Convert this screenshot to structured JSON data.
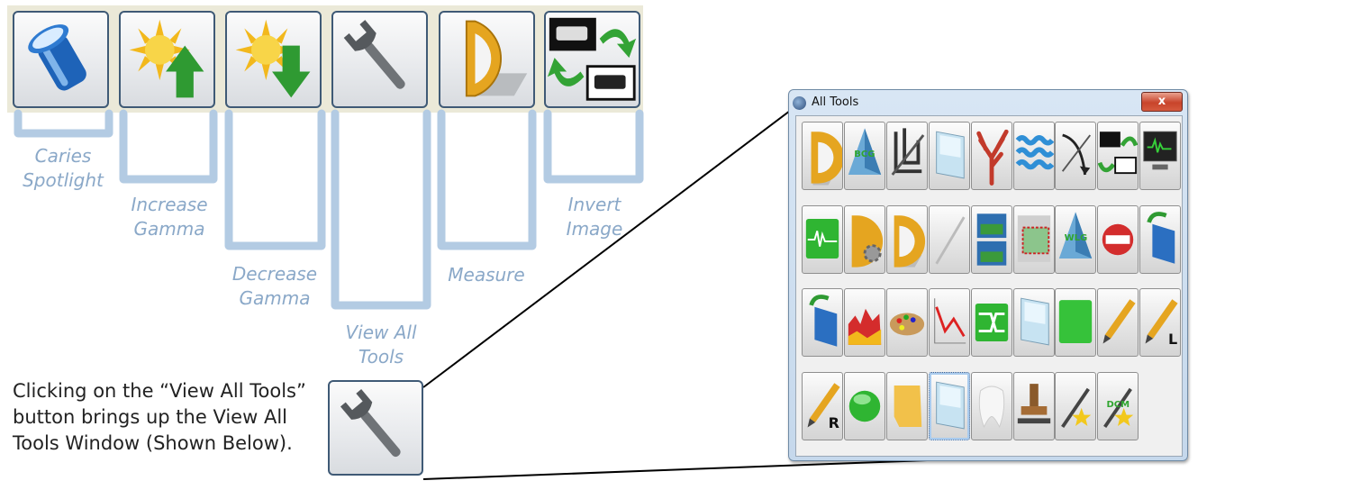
{
  "toolbar": {
    "buttons": [
      {
        "id": "caries-spotlight",
        "label": "Caries\nSpotlight"
      },
      {
        "id": "increase-gamma",
        "label": "Increase\nGamma"
      },
      {
        "id": "decrease-gamma",
        "label": "Decrease\nGamma"
      },
      {
        "id": "view-all-tools",
        "label": "View All\nTools"
      },
      {
        "id": "measure",
        "label": "Measure"
      },
      {
        "id": "invert-image",
        "label": "Invert\nImage"
      }
    ]
  },
  "description": "Clicking on the “View All Tools” button brings up the View All Tools Window (Shown Below).",
  "window": {
    "title": "All Tools",
    "close_label": "x",
    "tools": [
      {
        "icon": "ruler-icon"
      },
      {
        "icon": "bcg-icon",
        "text": "BCG"
      },
      {
        "icon": "crop-icon"
      },
      {
        "icon": "pane-icon"
      },
      {
        "icon": "coral-icon"
      },
      {
        "icon": "wave-icon"
      },
      {
        "icon": "curve-icon"
      },
      {
        "icon": "invert-image-icon"
      },
      {
        "icon": "monitor-icon"
      },
      {
        "icon": "green-waveform-icon"
      },
      {
        "icon": "measure-settings-icon"
      },
      {
        "icon": "measure-icon"
      },
      {
        "icon": "needle-icon"
      },
      {
        "icon": "image-pair-icon"
      },
      {
        "icon": "image-frame-icon"
      },
      {
        "icon": "wlg-icon",
        "text": "WLG"
      },
      {
        "icon": "no-entry-icon"
      },
      {
        "icon": "blue-flip-icon"
      },
      {
        "icon": "blue-rotate-icon"
      },
      {
        "icon": "histogram-icon"
      },
      {
        "icon": "palette-icon"
      },
      {
        "icon": "line-graph-icon"
      },
      {
        "icon": "shuffle-icon"
      },
      {
        "icon": "glass-pane-icon"
      },
      {
        "icon": "green-square-icon"
      },
      {
        "icon": "pencil-icon"
      },
      {
        "icon": "pencil-l-icon",
        "text": "L"
      },
      {
        "icon": "pencil-r-icon",
        "text": "R"
      },
      {
        "icon": "green-circle-icon"
      },
      {
        "icon": "yellow-note-icon"
      },
      {
        "icon": "selected-pane-icon",
        "selected": true
      },
      {
        "icon": "tooth-icon"
      },
      {
        "icon": "stamp-icon"
      },
      {
        "icon": "magic-tool-icon"
      },
      {
        "icon": "dcm-icon",
        "text": "DCM"
      }
    ]
  }
}
